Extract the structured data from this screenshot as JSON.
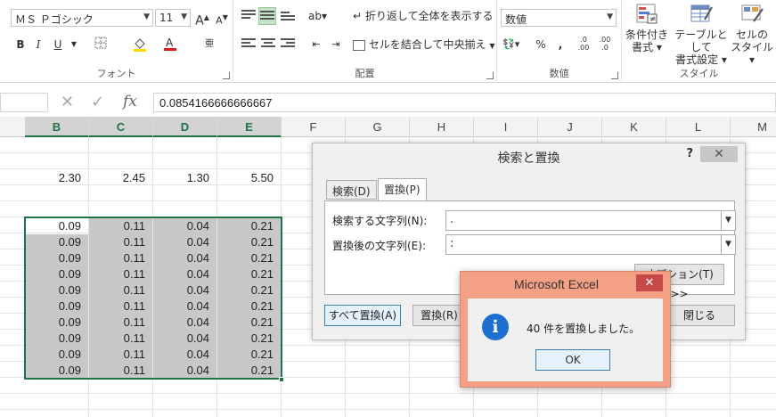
{
  "ribbon": {
    "font": {
      "name": "ＭＳ Ｐゴシック",
      "size": "11",
      "grow_label": "A",
      "shrink_label": "A",
      "bold_label": "B",
      "italic_label": "I",
      "underline_label": "U",
      "group_label": "フォント"
    },
    "alignment": {
      "wrap_label": "折り返して全体を表示する",
      "merge_label": "セルを結合して中央揃え",
      "group_label": "配置"
    },
    "number": {
      "format": "数値",
      "percent_label": "%",
      "comma_label": ",",
      "group_label": "数値"
    },
    "styles": {
      "conditional_line1": "条件付き",
      "conditional_line2": "書式",
      "table_line1": "テーブルとして",
      "table_line2": "書式設定",
      "cell_line1": "セルの",
      "cell_line2": "スタイル",
      "group_label": "スタイル"
    }
  },
  "formula_bar": {
    "value": "0.0854166666666667",
    "fx_label": "fx"
  },
  "grid": {
    "columns": [
      "B",
      "C",
      "D",
      "E",
      "F",
      "G",
      "H",
      "I",
      "J",
      "K",
      "L",
      "M"
    ],
    "selected_columns": [
      "B",
      "C",
      "D",
      "E"
    ],
    "header_row": [
      "2.30",
      "2.45",
      "1.30",
      "5.50"
    ],
    "data_rows": [
      [
        "0.09",
        "0.11",
        "0.04",
        "0.21"
      ],
      [
        "0.09",
        "0.11",
        "0.04",
        "0.21"
      ],
      [
        "0.09",
        "0.11",
        "0.04",
        "0.21"
      ],
      [
        "0.09",
        "0.11",
        "0.04",
        "0.21"
      ],
      [
        "0.09",
        "0.11",
        "0.04",
        "0.21"
      ],
      [
        "0.09",
        "0.11",
        "0.04",
        "0.21"
      ],
      [
        "0.09",
        "0.11",
        "0.04",
        "0.21"
      ],
      [
        "0.09",
        "0.11",
        "0.04",
        "0.21"
      ],
      [
        "0.09",
        "0.11",
        "0.04",
        "0.21"
      ],
      [
        "0.09",
        "0.11",
        "0.04",
        "0.21"
      ]
    ]
  },
  "find_dialog": {
    "title": "検索と置換",
    "help": "?",
    "tab_find": "検索(D)",
    "tab_replace": "置換(P)",
    "find_label": "検索する文字列(N):",
    "find_value": ".",
    "replace_label": "置換後の文字列(E):",
    "replace_value": ":",
    "options_button": "オプション(T) >>",
    "replace_all_button": "すべて置換(A)",
    "replace_button": "置換(R)",
    "close_button": "閉じる"
  },
  "message_box": {
    "title": "Microsoft Excel",
    "message": "40 件を置換しました。",
    "ok_button": "OK",
    "icon": "info-icon"
  },
  "colors": {
    "excel_green": "#217346",
    "selection_fill": "#c8c8c8",
    "msgbox_frame": "#f4a084",
    "info_blue": "#1c6fd1"
  }
}
